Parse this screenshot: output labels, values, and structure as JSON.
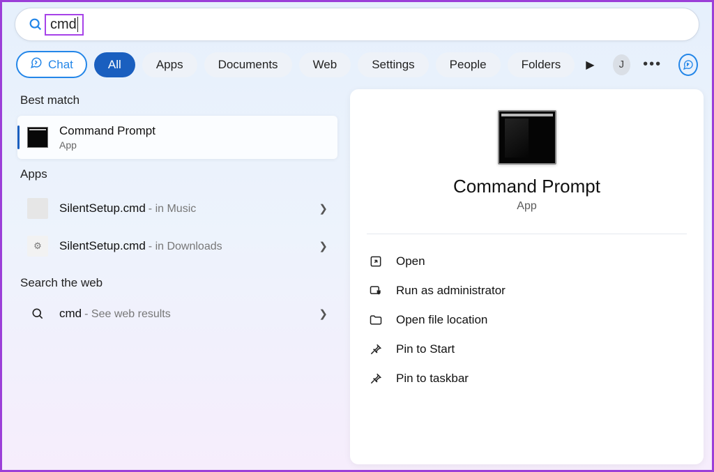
{
  "search": {
    "query": "cmd"
  },
  "filters": {
    "chat": "Chat",
    "tabs": [
      "All",
      "Apps",
      "Documents",
      "Web",
      "Settings",
      "People",
      "Folders"
    ],
    "avatar_initial": "J"
  },
  "left": {
    "best_match_label": "Best match",
    "best_match": {
      "title": "Command Prompt",
      "subtitle": "App"
    },
    "apps_label": "Apps",
    "apps": [
      {
        "name": "SilentSetup.cmd",
        "location": "- in Music"
      },
      {
        "name": "SilentSetup.cmd",
        "location": "- in Downloads"
      }
    ],
    "web_label": "Search the web",
    "web_query": "cmd",
    "web_hint": "- See web results"
  },
  "right": {
    "title": "Command Prompt",
    "subtitle": "App",
    "actions": {
      "open": "Open",
      "admin": "Run as administrator",
      "file_loc": "Open file location",
      "pin_start": "Pin to Start",
      "pin_taskbar": "Pin to taskbar"
    }
  }
}
